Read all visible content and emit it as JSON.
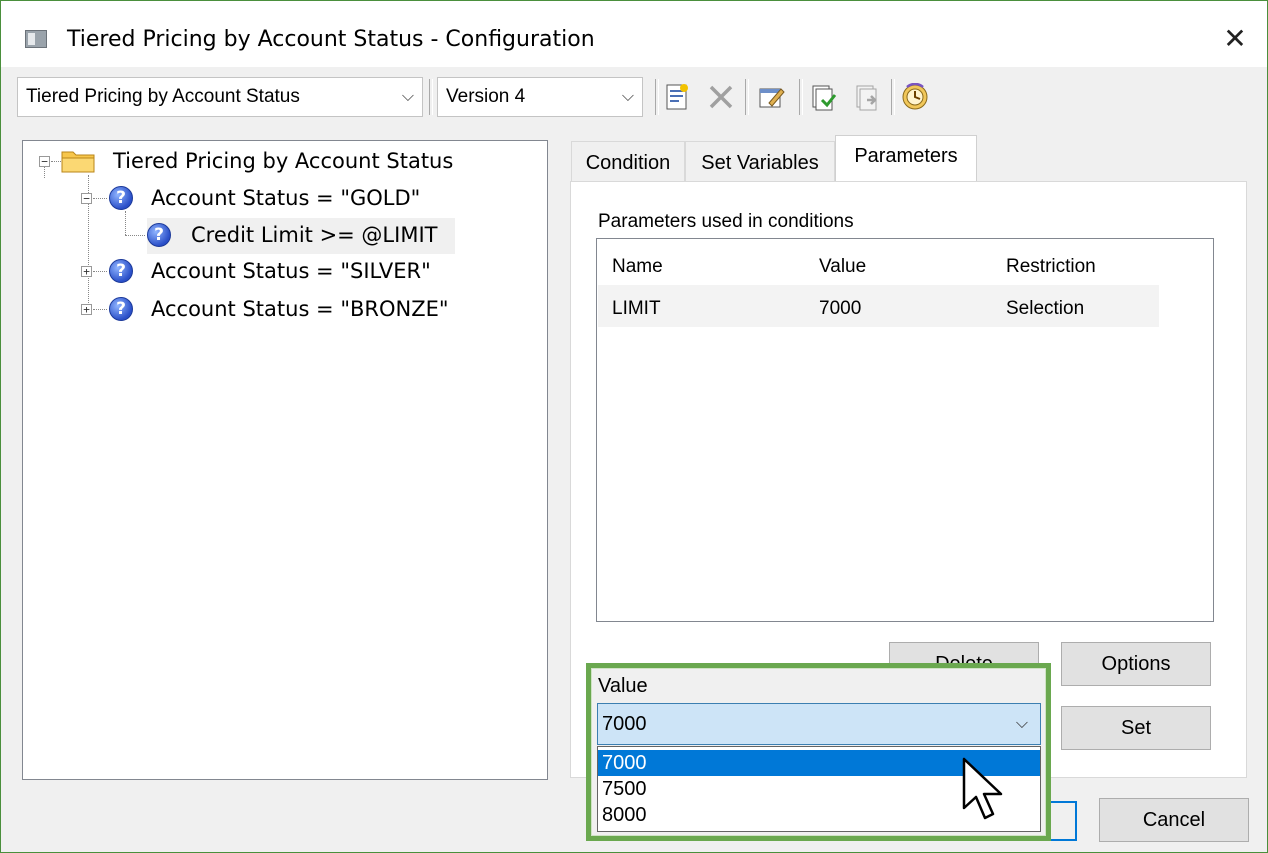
{
  "window": {
    "title": "Tiered Pricing by Account Status - Configuration",
    "close_glyph": "✕"
  },
  "toolbar": {
    "ruleset_combo": "Tiered Pricing by Account Status",
    "version_combo": "Version 4",
    "dropdown_glyph": "⌵",
    "icons": [
      "new-rule-icon",
      "delete-icon",
      "edit-icon",
      "import-icon",
      "export-icon",
      "history-icon"
    ]
  },
  "tree": {
    "root": "Tiered Pricing by Account Status",
    "items": [
      {
        "label": "Account Status = \"GOLD\"",
        "expander": "−"
      },
      {
        "label": "Credit Limit >= @LIMIT"
      },
      {
        "label": "Account Status = \"SILVER\"",
        "expander": "+"
      },
      {
        "label": "Account Status = \"BRONZE\"",
        "expander": "+"
      }
    ]
  },
  "tabs": [
    "Condition",
    "Set Variables",
    "Parameters"
  ],
  "active_tab": "Parameters",
  "parameters": {
    "label": "Parameters used in conditions",
    "columns": [
      "Name",
      "Value",
      "Restriction"
    ],
    "rows": [
      [
        "LIMIT",
        "7000",
        "Selection"
      ]
    ]
  },
  "buttons": {
    "delete": "Delete",
    "options": "Options",
    "set": "Set",
    "cancel": "Cancel"
  },
  "value_editor": {
    "label": "Value",
    "selected": "7000",
    "options": [
      "7000",
      "7500",
      "8000"
    ]
  },
  "colors": {
    "highlight": "#6aa84f",
    "selection": "#0078d7",
    "combo_focus": "#cde4f7"
  }
}
